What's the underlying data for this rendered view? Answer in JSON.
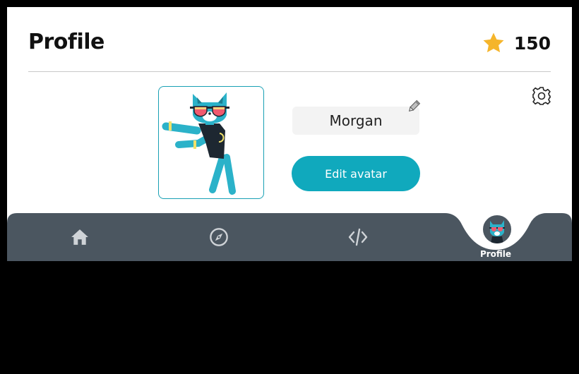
{
  "header": {
    "title": "Profile",
    "points": "150",
    "star_color": "#f5b52b"
  },
  "profile": {
    "username": "Morgan",
    "edit_avatar_label": "Edit avatar",
    "accent_color": "#10a9bd"
  },
  "icons": {
    "star": "star-icon",
    "pencil": "pencil-icon",
    "settings": "gear-icon",
    "home": "home-icon",
    "explore": "compass-icon",
    "code": "code-icon"
  },
  "nav": {
    "items": [
      {
        "id": "home",
        "label": ""
      },
      {
        "id": "explore",
        "label": ""
      },
      {
        "id": "code",
        "label": ""
      },
      {
        "id": "profile",
        "label": "Profile",
        "active": true
      }
    ],
    "background_color": "#4b5660"
  }
}
